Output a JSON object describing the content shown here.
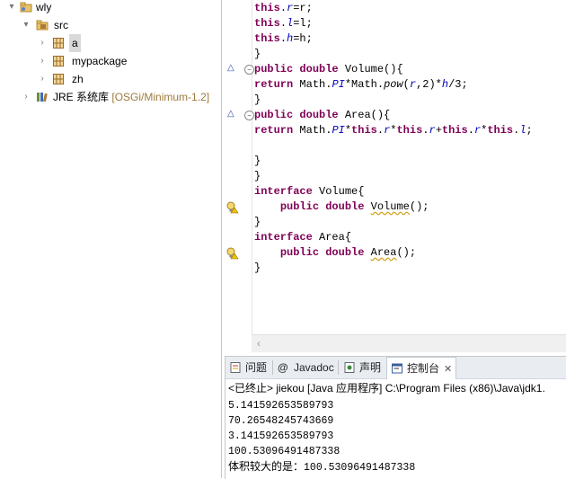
{
  "explorer": {
    "project": "wly",
    "src": "src",
    "packages": [
      "a",
      "mypackage",
      "zh"
    ],
    "jre": {
      "label": "JRE 系统库",
      "detail": "[OSGi/Minimum-1.2]"
    }
  },
  "editor": {
    "lines": [
      [
        {
          "t": "this",
          "c": "kw"
        },
        {
          "t": "."
        },
        {
          "t": "r",
          "c": "fld"
        },
        {
          "t": "=r;"
        }
      ],
      [
        {
          "t": "this",
          "c": "kw"
        },
        {
          "t": "."
        },
        {
          "t": "l",
          "c": "fld"
        },
        {
          "t": "=l;"
        }
      ],
      [
        {
          "t": "this",
          "c": "kw"
        },
        {
          "t": "."
        },
        {
          "t": "h",
          "c": "fld"
        },
        {
          "t": "=h;"
        }
      ],
      [
        {
          "t": "}"
        }
      ],
      [
        {
          "t": "public",
          "c": "kw"
        },
        {
          "t": " "
        },
        {
          "t": "double",
          "c": "kw"
        },
        {
          "t": " Volume(){"
        }
      ],
      [
        {
          "t": "return",
          "c": "kw"
        },
        {
          "t": " Math."
        },
        {
          "t": "PI",
          "c": "fld"
        },
        {
          "t": "*Math."
        },
        {
          "t": "pow",
          "c": "it"
        },
        {
          "t": "("
        },
        {
          "t": "r",
          "c": "fld"
        },
        {
          "t": ",2)*"
        },
        {
          "t": "h",
          "c": "fld"
        },
        {
          "t": "/3;"
        }
      ],
      [
        {
          "t": "}"
        }
      ],
      [
        {
          "t": "public",
          "c": "kw"
        },
        {
          "t": " "
        },
        {
          "t": "double",
          "c": "kw"
        },
        {
          "t": " Area(){"
        }
      ],
      [
        {
          "t": "return",
          "c": "kw"
        },
        {
          "t": " Math."
        },
        {
          "t": "PI",
          "c": "fld"
        },
        {
          "t": "*"
        },
        {
          "t": "this",
          "c": "kw"
        },
        {
          "t": "."
        },
        {
          "t": "r",
          "c": "fld"
        },
        {
          "t": "*"
        },
        {
          "t": "this",
          "c": "kw"
        },
        {
          "t": "."
        },
        {
          "t": "r",
          "c": "fld"
        },
        {
          "t": "+"
        },
        {
          "t": "this",
          "c": "kw"
        },
        {
          "t": "."
        },
        {
          "t": "r",
          "c": "fld"
        },
        {
          "t": "*"
        },
        {
          "t": "this",
          "c": "kw"
        },
        {
          "t": "."
        },
        {
          "t": "l",
          "c": "fld"
        },
        {
          "t": ";"
        }
      ],
      [
        {
          "t": ""
        }
      ],
      [
        {
          "t": "}"
        }
      ],
      [
        {
          "t": "}"
        }
      ],
      [
        {
          "t": "interface",
          "c": "kw"
        },
        {
          "t": " Volume{"
        }
      ],
      [
        {
          "t": "    "
        },
        {
          "t": "public",
          "c": "kw"
        },
        {
          "t": " "
        },
        {
          "t": "double",
          "c": "kw"
        },
        {
          "t": " "
        },
        {
          "t": "Volume",
          "c": "warn"
        },
        {
          "t": "();"
        }
      ],
      [
        {
          "t": "}"
        }
      ],
      [
        {
          "t": "interface",
          "c": "kw"
        },
        {
          "t": " Area{"
        }
      ],
      [
        {
          "t": "    "
        },
        {
          "t": "public",
          "c": "kw"
        },
        {
          "t": " "
        },
        {
          "t": "double",
          "c": "kw"
        },
        {
          "t": " "
        },
        {
          "t": "Area",
          "c": "warn"
        },
        {
          "t": "();"
        }
      ],
      [
        {
          "t": "}"
        }
      ]
    ]
  },
  "panel": {
    "tabs": [
      {
        "label": "问题",
        "icon": "problems-icon"
      },
      {
        "label": "Javadoc",
        "icon": "at-icon"
      },
      {
        "label": "声明",
        "icon": "declaration-icon"
      },
      {
        "label": "控制台",
        "icon": "console-icon",
        "active": true
      }
    ],
    "console_header": "<已终止> jiekou [Java 应用程序] C:\\Program Files (x86)\\Java\\jdk1.",
    "output": [
      "5.141592653589793",
      "70.26548245743669",
      "3.141592653589793",
      "100.53096491487338"
    ],
    "final_label": "体积较大的是：",
    "final_value": "100.53096491487338"
  },
  "colors": {
    "keyword": "#7f0055",
    "field": "#0000c0",
    "warning": "#d4a017",
    "selection": "#d9d9d9",
    "tabbar": "#e9edf2"
  }
}
